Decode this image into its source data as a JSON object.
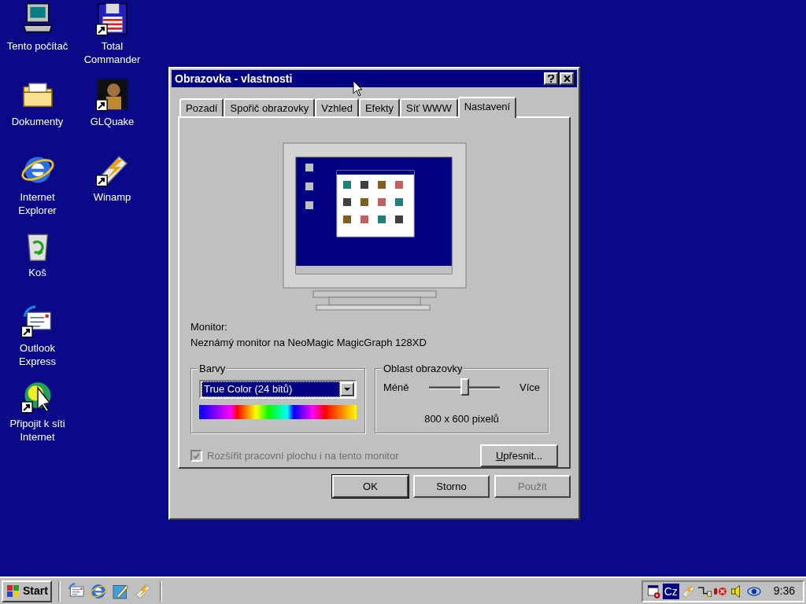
{
  "desktop": {
    "columns": [
      [
        {
          "label": "Tento počítač",
          "kind": "computer",
          "shortcut": false
        },
        {
          "label": "Dokumenty",
          "kind": "folder",
          "shortcut": false
        },
        {
          "label": "Internet Explorer",
          "kind": "browser",
          "shortcut": false
        },
        {
          "label": "Koš",
          "kind": "bin",
          "shortcut": false
        },
        {
          "label": "Outlook Express",
          "kind": "mail",
          "shortcut": true
        },
        {
          "label": "Připojit k síti Internet",
          "kind": "connect",
          "shortcut": true
        }
      ],
      [
        {
          "label": "Total Commander",
          "kind": "floppy",
          "shortcut": true
        },
        {
          "label": "GLQuake",
          "kind": "game",
          "shortcut": true
        },
        {
          "label": "Winamp",
          "kind": "lightning",
          "shortcut": true
        }
      ]
    ]
  },
  "window": {
    "title": "Obrazovka - vlastnosti",
    "tabs": [
      {
        "label": "Pozadí",
        "selected": false
      },
      {
        "label": "Spořič obrazovky",
        "selected": false
      },
      {
        "label": "Vzhled",
        "selected": false
      },
      {
        "label": "Efekty",
        "selected": false
      },
      {
        "label": "Síť WWW",
        "selected": false
      },
      {
        "label": "Nastavení",
        "selected": true
      }
    ],
    "monitor_label": "Monitor:",
    "monitor_name": "Neznámý monitor na NeoMagic MagicGraph 128XD",
    "colors": {
      "title": "Barvy",
      "value": "True Color (24 bitů)"
    },
    "area": {
      "title": "Oblast obrazovky",
      "min_label": "Méně",
      "max_label": "Více",
      "level": 0.5,
      "reading": "800 x 600 pixelů"
    },
    "extend": {
      "label": "Rozšířit pracovní plochu i na tento monitor",
      "checked": true,
      "disabled": true
    },
    "advanced_button": "Upřesnit...",
    "buttons": [
      {
        "label": "OK",
        "default": true,
        "disabled": false
      },
      {
        "label": "Storno",
        "default": false,
        "disabled": false
      },
      {
        "label": "Použít",
        "default": false,
        "disabled": true
      }
    ]
  },
  "taskbar": {
    "start": "Start",
    "quick_launch": [
      {
        "kind": "mail"
      },
      {
        "kind": "browser"
      },
      {
        "kind": "pencil"
      },
      {
        "kind": "lightning"
      }
    ],
    "tray": [
      {
        "kind": "scheduler"
      },
      {
        "kind": "text",
        "label": "Cz"
      },
      {
        "kind": "lightning"
      },
      {
        "kind": "plug"
      },
      {
        "kind": "stop"
      },
      {
        "kind": "speaker"
      },
      {
        "kind": "eye"
      }
    ],
    "time": "9:36"
  }
}
